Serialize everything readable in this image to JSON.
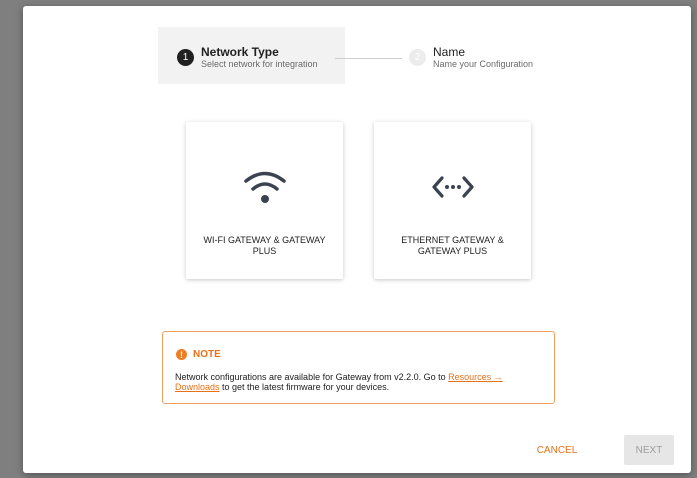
{
  "stepper": {
    "steps": [
      {
        "number": "1",
        "title": "Network Type",
        "subtitle": "Select network for integration",
        "state": "active"
      },
      {
        "number": "2",
        "title": "Name",
        "subtitle": "Name your Configuration",
        "state": "inactive"
      }
    ]
  },
  "cards": [
    {
      "label": "WI-FI GATEWAY & GATEWAY PLUS",
      "icon": "wifi-icon"
    },
    {
      "label": "ETHERNET GATEWAY & GATEWAY PLUS",
      "icon": "ethernet-icon"
    }
  ],
  "note": {
    "icon": "info-icon",
    "icon_glyph": "!",
    "title": "NOTE",
    "text_before": "Network configurations are available for Gateway from v2.2.0. Go to ",
    "link_part1": "Resources →",
    "link_part2": "Downloads",
    "text_after": " to get the latest firmware for your devices."
  },
  "actions": {
    "cancel_label": "CANCEL",
    "next_label": "NEXT"
  },
  "colors": {
    "accent": "#e8711a",
    "note_border": "#f2a064",
    "icon": "#3b4350"
  }
}
